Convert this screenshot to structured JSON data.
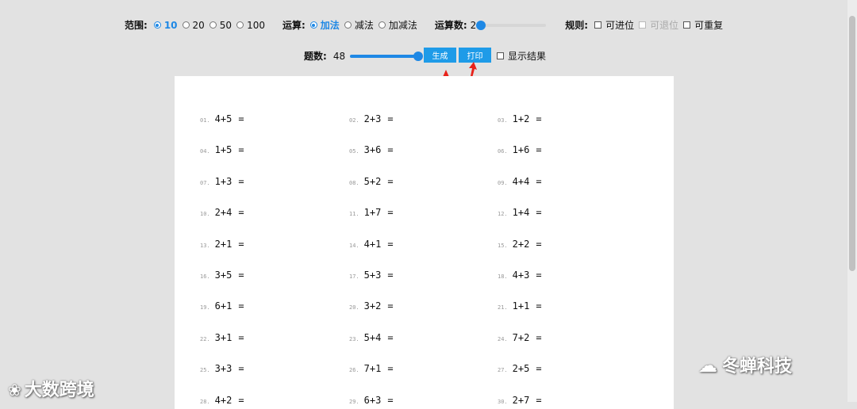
{
  "toolbar": {
    "range_label": "范围:",
    "range_options": [
      "10",
      "20",
      "50",
      "100"
    ],
    "range_selected": "10",
    "op_label": "运算:",
    "op_options": [
      "加法",
      "减法",
      "加减法"
    ],
    "op_selected": "加法",
    "count_label": "运算数:",
    "count_value": "2",
    "rule_label": "规则:",
    "rules": [
      {
        "label": "可进位",
        "checked": false,
        "disabled": false
      },
      {
        "label": "可退位",
        "checked": false,
        "disabled": true
      },
      {
        "label": "可重复",
        "checked": false,
        "disabled": false
      }
    ],
    "qty_label": "题数:",
    "qty_value": "48",
    "generate_label": "生成",
    "print_label": "打印",
    "show_result_label": "显示结果"
  },
  "problems": [
    [
      "01.",
      "4+5"
    ],
    [
      "02.",
      "2+3"
    ],
    [
      "03.",
      "1+2"
    ],
    [
      "04.",
      "1+5"
    ],
    [
      "05.",
      "3+6"
    ],
    [
      "06.",
      "1+6"
    ],
    [
      "07.",
      "1+3"
    ],
    [
      "08.",
      "5+2"
    ],
    [
      "09.",
      "4+4"
    ],
    [
      "10.",
      "2+4"
    ],
    [
      "11.",
      "1+7"
    ],
    [
      "12.",
      "1+4"
    ],
    [
      "13.",
      "2+1"
    ],
    [
      "14.",
      "4+1"
    ],
    [
      "15.",
      "2+2"
    ],
    [
      "16.",
      "3+5"
    ],
    [
      "17.",
      "5+3"
    ],
    [
      "18.",
      "4+3"
    ],
    [
      "19.",
      "6+1"
    ],
    [
      "20.",
      "3+2"
    ],
    [
      "21.",
      "1+1"
    ],
    [
      "22.",
      "3+1"
    ],
    [
      "23.",
      "5+4"
    ],
    [
      "24.",
      "7+2"
    ],
    [
      "25.",
      "3+3"
    ],
    [
      "26.",
      "7+1"
    ],
    [
      "27.",
      "2+5"
    ],
    [
      "28.",
      "4+2"
    ],
    [
      "29.",
      "6+3"
    ],
    [
      "30.",
      "2+7"
    ]
  ],
  "equals": "=",
  "watermarks": {
    "left": "大数跨境",
    "right": "冬蝉科技"
  },
  "colors": {
    "accent": "#1e88e5",
    "button": "#1e9be8",
    "arrow": "#e8221a"
  }
}
